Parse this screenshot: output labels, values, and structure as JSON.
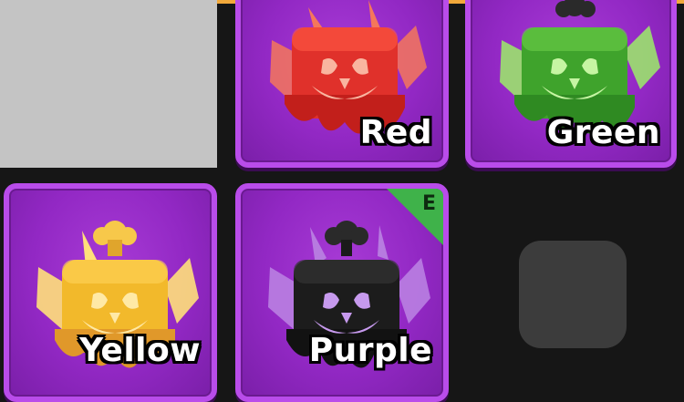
{
  "inventory": {
    "slots": [
      {
        "label": "Red",
        "color": "#e0312b",
        "highlight": "#f5775a"
      },
      {
        "label": "Green",
        "color": "#3fa32c",
        "highlight": "#9be26d"
      },
      {
        "label": "Yellow",
        "color": "#f2b92b",
        "highlight": "#ffe07a"
      },
      {
        "label": "Purple",
        "color": "#1c1c1c",
        "highlight": "#b77be0",
        "badge": "E"
      }
    ]
  },
  "colors": {
    "slot_background": "#9228c4",
    "slot_border": "#b94cea",
    "badge": "#3fb24a",
    "top_border": "#f2a93b",
    "page_background": "#161616"
  }
}
